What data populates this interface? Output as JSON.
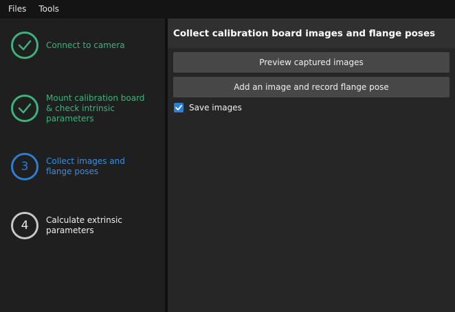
{
  "menu": {
    "files": "Files",
    "tools": "Tools"
  },
  "steps": [
    {
      "number": "",
      "label": "Connect to camera",
      "status": "done"
    },
    {
      "number": "",
      "label": "Mount calibration board & check intrinsic parameters",
      "status": "done"
    },
    {
      "number": "3",
      "label": "Collect images and flange poses",
      "status": "active"
    },
    {
      "number": "4",
      "label": "Calculate extrinsic parameters",
      "status": "pending"
    }
  ],
  "main": {
    "title": "Collect calibration board images and flange poses",
    "preview_button": "Preview captured images",
    "add_button": "Add an image and record flange pose",
    "save_images_label": "Save images",
    "save_images_checked": true
  },
  "colors": {
    "done": "#3db47d",
    "active": "#2d7fd2",
    "pending": "#c8c8c8"
  }
}
